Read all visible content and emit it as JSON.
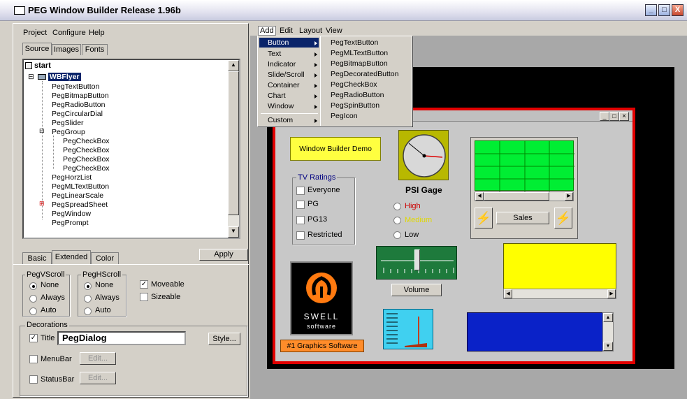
{
  "window": {
    "title": "PEG Window Builder Release 1.96b",
    "min": "_",
    "max": "□",
    "close": "X"
  },
  "left_menu": [
    "Project",
    "Configure",
    "Help"
  ],
  "source_tabs": [
    "Source",
    "Images",
    "Fonts"
  ],
  "tree": {
    "root": "start",
    "selected": "WBFlyer",
    "items": [
      {
        "label": "PegTextButton"
      },
      {
        "label": "PegBitmapButton"
      },
      {
        "label": "PegRadioButton"
      },
      {
        "label": "PegCircularDial"
      },
      {
        "label": "PegSlider"
      },
      {
        "label": "PegGroup"
      },
      {
        "label": "PegCheckBox"
      },
      {
        "label": "PegCheckBox"
      },
      {
        "label": "PegCheckBox"
      },
      {
        "label": "PegCheckBox"
      },
      {
        "label": "PegHorzList"
      },
      {
        "label": "PegMLTextButton"
      },
      {
        "label": "PegLinearScale"
      },
      {
        "label": "PegSpreadSheet"
      },
      {
        "label": "PegWindow"
      },
      {
        "label": "PegPrompt"
      }
    ]
  },
  "props_tabs": [
    "Basic",
    "Extended",
    "Color"
  ],
  "apply_label": "Apply",
  "vscroll": {
    "title": "PegVScroll",
    "options": [
      "None",
      "Always",
      "Auto"
    ],
    "selected": "None"
  },
  "hscroll": {
    "title": "PegHScroll",
    "options": [
      "None",
      "Always",
      "Auto"
    ],
    "selected": "None"
  },
  "moveable": {
    "label": "Moveable",
    "checked": true
  },
  "sizeable": {
    "label": "Sizeable",
    "checked": false
  },
  "decorations": {
    "title": "Decorations",
    "title_label": "Title",
    "title_value": "PegDialog",
    "style_label": "Style...",
    "menubar_label": "MenuBar",
    "statusbar_label": "StatusBar",
    "edit_label": "Edit..."
  },
  "canvas_menu": [
    "Add",
    "Edit",
    "Layout",
    "View"
  ],
  "add_menu": [
    "Button",
    "Text",
    "Indicator",
    "Slide/Scroll",
    "Container",
    "Chart",
    "Window",
    "Custom"
  ],
  "button_submenu": [
    "PegTextButton",
    "PegMLTextButton",
    "PegBitmapButton",
    "PegDecoratedButton",
    "PegCheckBox",
    "PegRadioButton",
    "PegSpinButton",
    "PegIcon"
  ],
  "flyer": {
    "demo_button": "Window Builder Demo",
    "tv_ratings": {
      "title": "TV Ratings",
      "options": [
        "Everyone",
        "PG",
        "PG13",
        "Restricted"
      ]
    },
    "gauge_title": "PSI Gage",
    "gauge_options": [
      "High",
      "Medium",
      "Low"
    ],
    "volume_label": "Volume",
    "sales_label": "Sales",
    "swell_1": "SWELL",
    "swell_2": "software",
    "graphics_label": "#1 Graphics Software"
  },
  "colors": {
    "green_grid": "#00ee33",
    "yellow_panel": "#ffff00",
    "blue_panel": "#0a22c8",
    "red_border": "#e10000",
    "high_text": "#cc0000",
    "medium_text": "#e0d800"
  }
}
